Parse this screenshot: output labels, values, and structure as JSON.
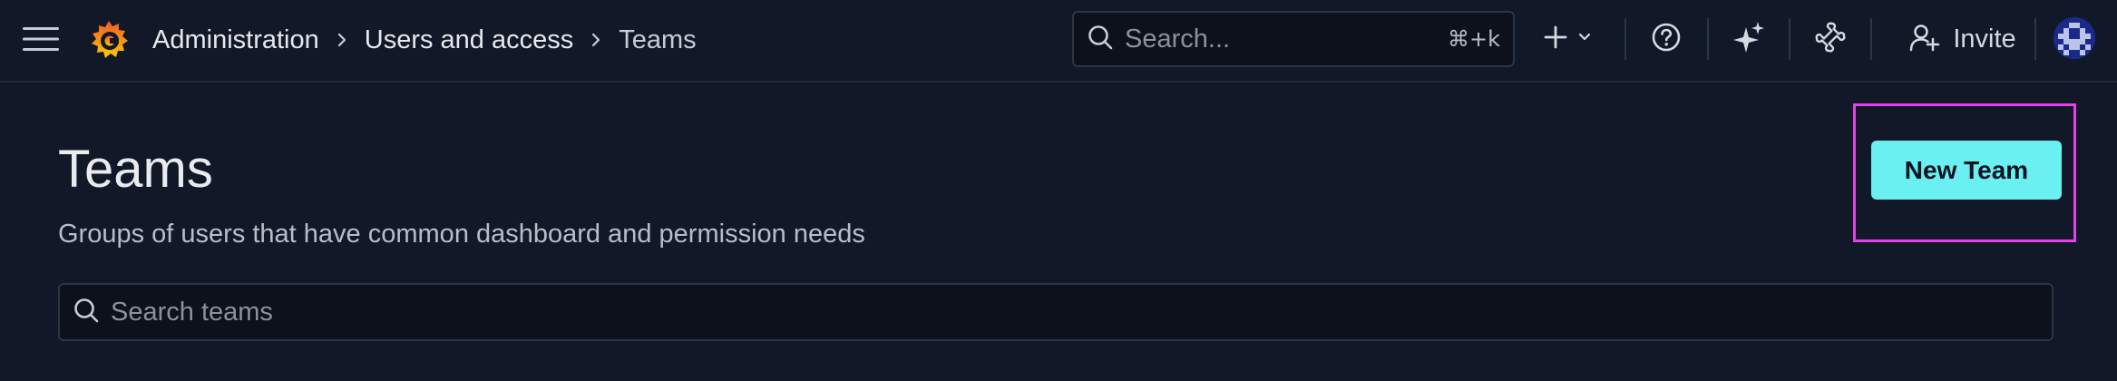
{
  "topbar": {
    "menu_icon": "hamburger-menu-icon",
    "logo_icon": "grafana-logo-icon",
    "breadcrumb": [
      {
        "label": "Administration"
      },
      {
        "label": "Users and access"
      },
      {
        "label": "Teams"
      }
    ],
    "search": {
      "placeholder": "Search...",
      "shortcut": "⌘+k"
    },
    "add_icon": "plus-icon",
    "help_icon": "help-circle-icon",
    "assistant_icon": "sparkle-icon",
    "plugin_icon": "bone-icon",
    "invite_label": "Invite"
  },
  "page": {
    "title": "Teams",
    "subtitle": "Groups of users that have common dashboard and permission needs",
    "new_team_label": "New Team",
    "search_placeholder": "Search teams"
  },
  "colors": {
    "background": "#111827",
    "primary_button": "#6af0f0",
    "highlight": "#e144e4",
    "logo_orange": "#f47a29"
  }
}
